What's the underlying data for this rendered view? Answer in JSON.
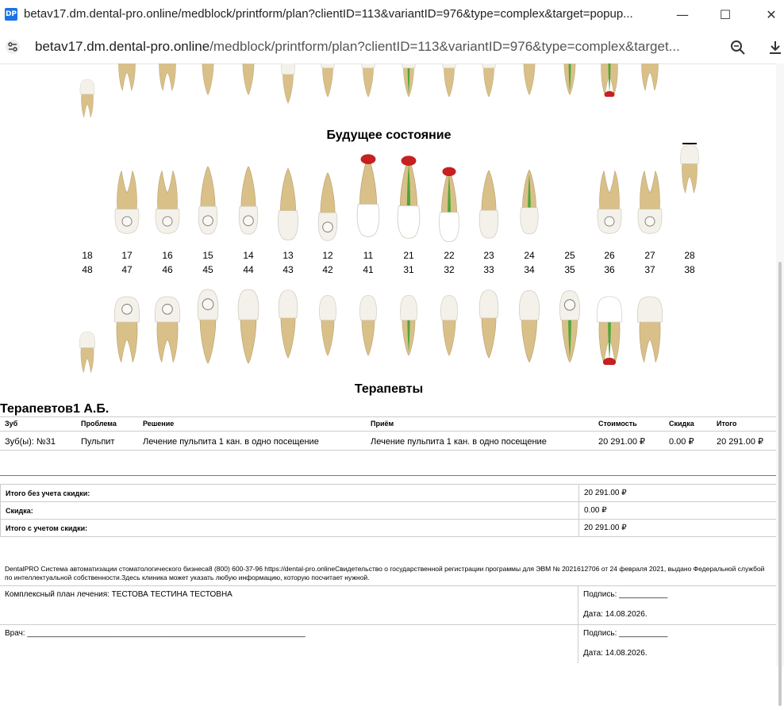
{
  "window": {
    "title": "betav17.dm.dental-pro.online/medblock/printform/plan?clientID=113&variantID=976&type=complex&target=popup...",
    "logo": "DP",
    "minimize": "—",
    "maximize": "☐",
    "close": "✕"
  },
  "address": {
    "host": "betav17.dm.dental-pro.online",
    "path": "/medblock/printform/plan?clientID=113&variantID=976&type=complex&target...",
    "icons": [
      "tune-icon",
      "zoom-icon",
      "download-icon"
    ]
  },
  "section_future": "Будущее состояние",
  "upper_numbers": [
    "18",
    "17",
    "16",
    "15",
    "14",
    "13",
    "12",
    "11",
    "21",
    "22",
    "23",
    "24",
    "25",
    "26",
    "27",
    "28"
  ],
  "lower_numbers": [
    "48",
    "47",
    "46",
    "45",
    "44",
    "43",
    "42",
    "41",
    "31",
    "32",
    "33",
    "34",
    "35",
    "36",
    "37",
    "38"
  ],
  "section_therapists": "Терапевты",
  "doctor": "Терапевтов1 А.Б.",
  "table": {
    "headers": [
      "Зуб",
      "Проблема",
      "Решение",
      "Приём",
      "Стоимость",
      "Скидка",
      "Итого"
    ],
    "rows": [
      [
        "Зуб(ы): №31",
        "Пульпит",
        "Лечение пульпита 1 кан. в одно посещение",
        "Лечение пульпита 1 кан. в одно посещение",
        "20 291.00 ₽",
        "0.00 ₽",
        "20 291.00 ₽"
      ]
    ]
  },
  "totals": [
    {
      "label": "Итого без учета скидки:",
      "value": "20 291.00 ₽"
    },
    {
      "label": "Скидка:",
      "value": "0.00 ₽"
    },
    {
      "label": "Итого с учетом скидки:",
      "value": "20 291.00 ₽"
    }
  ],
  "footer": "DentalPRO Система автоматизации стоматологического бизнеса8 (800) 600-37-96 https://dental-pro.onlineСвидетельство о государственной регистрации программы для ЭВМ № 2021612706 от 24 февраля 2021, выдано Федеральной службой по интеллектуальной собственности.Здесь клиника может указать любую информацию, которую посчитает нужной.",
  "sign_rows": [
    {
      "left": "Комплексный план лечения: ТЕСТОВА ТЕСТИНА ТЕСТОВНА",
      "sign": "Подпись: ___________",
      "date": "Дата: 14.08.2026."
    },
    {
      "left": "Врач: _______________________________________________________________",
      "sign": "Подпись: ___________",
      "date": "Дата: 14.08.2026."
    }
  ],
  "colors": {
    "enamel": "#f3f1ea",
    "root": "#d9c089",
    "canal": "#4ea53a",
    "lesion": "#c62020",
    "accent": "#2a9d8f"
  }
}
